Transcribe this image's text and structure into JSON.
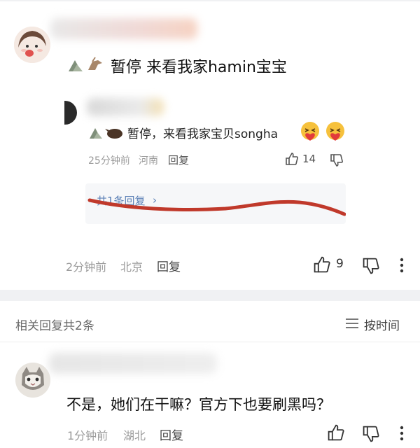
{
  "comment1": {
    "text": "暂停 来看我家hamin宝宝",
    "time": "2分钟前",
    "location": "北京",
    "reply_label": "回复",
    "likes": "9"
  },
  "nested_reply": {
    "text": "暂停，来看我家宝贝songha",
    "time": "25分钟前",
    "location": "河南",
    "reply_label": "回复",
    "likes": "14"
  },
  "replies_preview": {
    "label": "共1条回复"
  },
  "section": {
    "title": "相关回复共2条",
    "sort_label": "按时间"
  },
  "comment2": {
    "text": "不是，她们在干嘛？官方下也要刷黑吗？",
    "time": "1分钟前",
    "location": "湖北",
    "reply_label": "回复"
  },
  "colors": {
    "accent_red": "#c0392b",
    "meta_gray": "#9a9a9a",
    "link_blue": "#5a7fb5"
  }
}
